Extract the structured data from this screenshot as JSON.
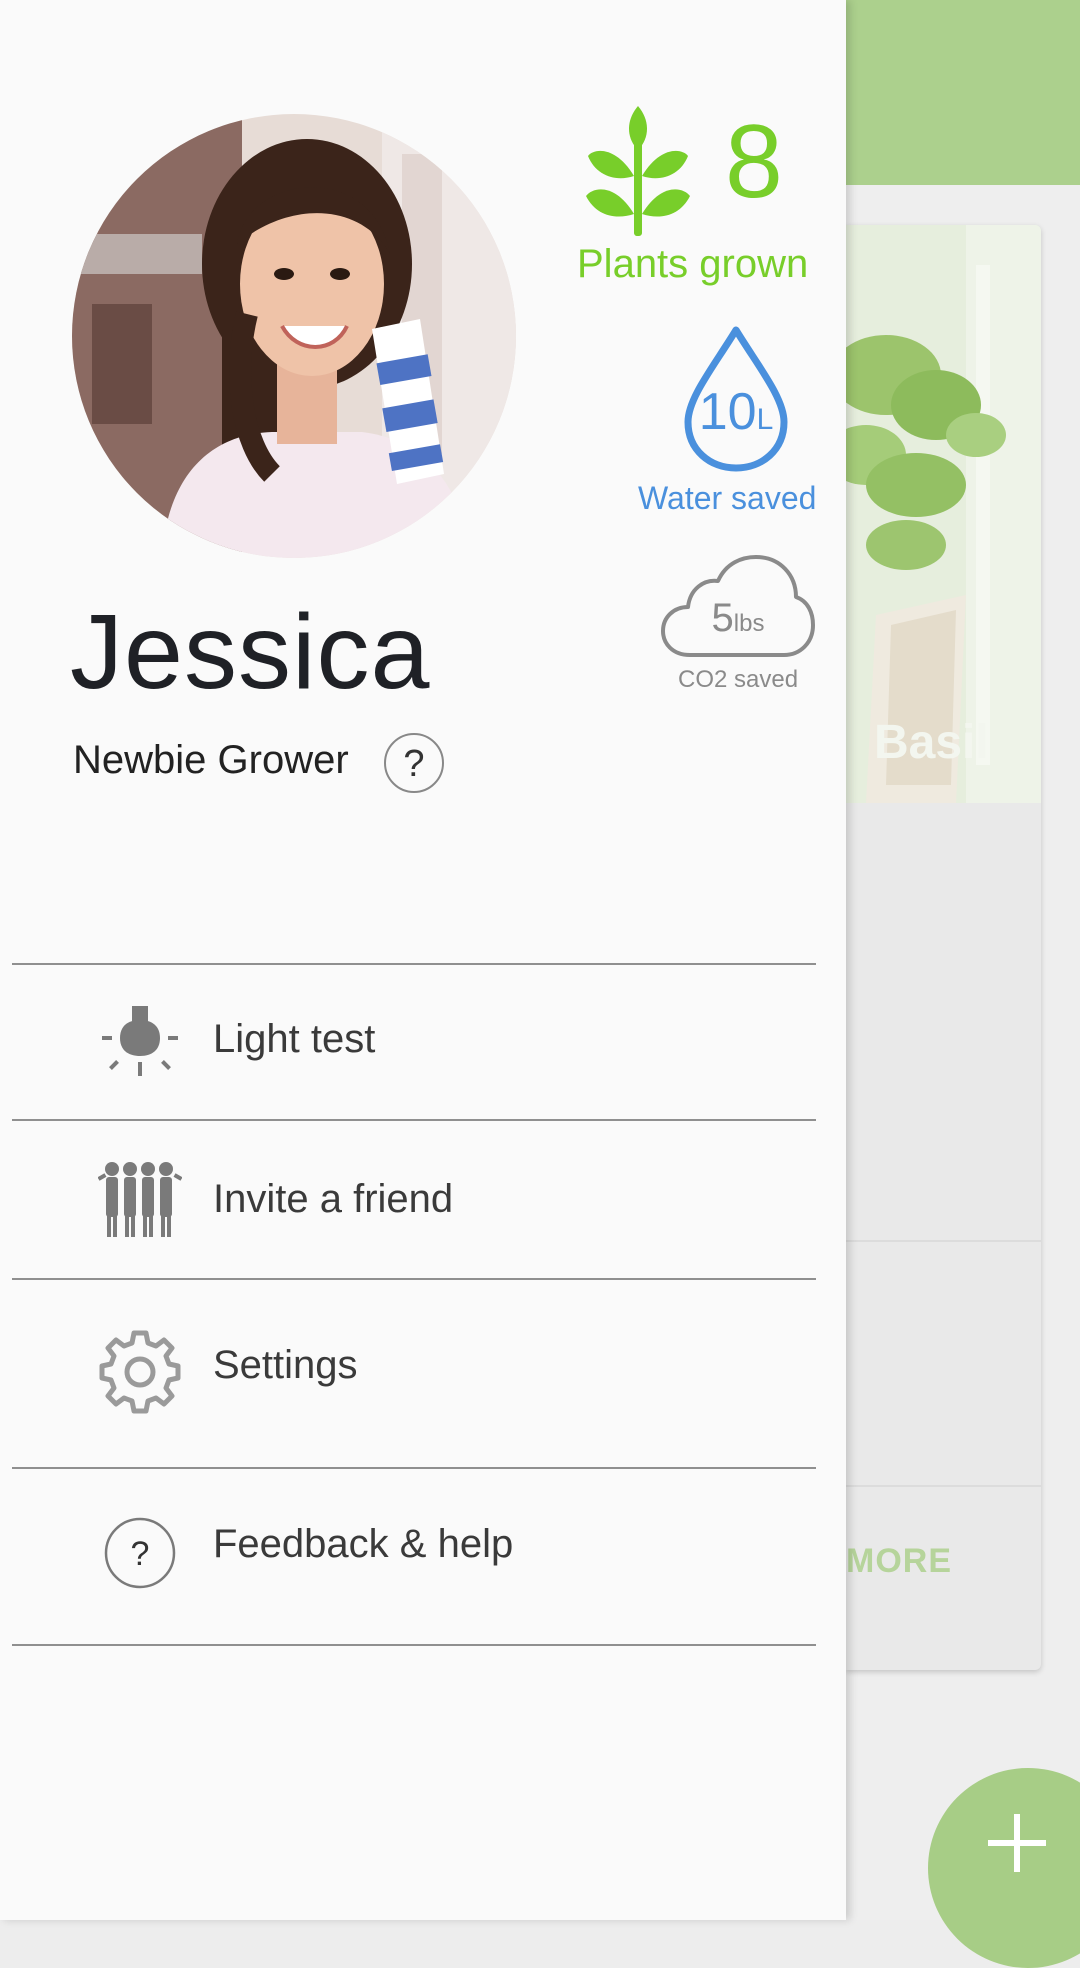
{
  "background_app": {
    "card_title": "Basil",
    "more_label": "MORE",
    "fab_label": "+"
  },
  "profile": {
    "name": "Jessica",
    "level": "Newbie Grower",
    "level_help": "?"
  },
  "stats": {
    "plants": {
      "count": "8",
      "label": "Plants grown",
      "color": "#78ce2a",
      "icon": "plant-icon"
    },
    "water": {
      "value": "10",
      "unit": "L",
      "label": "Water saved",
      "color": "#4a90dd",
      "icon": "water-drop-icon"
    },
    "co2": {
      "value": "5",
      "unit": "lbs",
      "label": "CO2 saved",
      "color": "#8a8a8a",
      "icon": "cloud-icon"
    }
  },
  "menu": [
    {
      "label": "Light test",
      "icon": "light-bulb-icon"
    },
    {
      "label": "Invite a friend",
      "icon": "people-icon"
    },
    {
      "label": "Settings",
      "icon": "gear-icon"
    },
    {
      "label": "Feedback & help",
      "icon": "help-circle-icon"
    }
  ],
  "colors": {
    "accent_green": "#78ce2a",
    "toolbar_green": "#acd08d",
    "water_blue": "#4a90dd"
  }
}
